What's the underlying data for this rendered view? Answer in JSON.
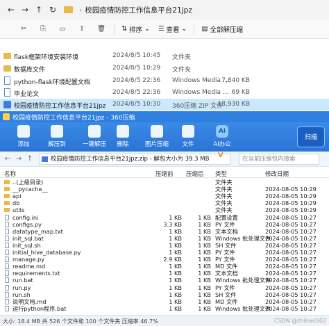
{
  "explorer": {
    "nav_back": "←",
    "nav_forward": "→",
    "nav_up": "↑",
    "nav_refresh": "↻",
    "breadcrumb_sep": "›",
    "path_title": "校园疫情防控工作信息平台21jpz",
    "ribbon": {
      "cut": "✂",
      "copy": "⎘",
      "rename": "▭",
      "share": "⇪",
      "delete": "🗑",
      "sort_label": "排序",
      "view_label": "查看",
      "extract_label": "全部解压缩"
    },
    "files": [
      {
        "name": "flask框架环境安装环境",
        "date": "2024/8/5 10:45",
        "type": "文件夹",
        "size": ""
      },
      {
        "name": "数据库文件",
        "date": "2024/8/5 10:29",
        "type": "文件夹",
        "size": ""
      },
      {
        "name": "python-flask环境配置文档",
        "date": "2024/8/5 22:36",
        "type": "Windows Media ...",
        "size": "7,840 KB"
      },
      {
        "name": "毕业论文",
        "date": "2024/8/5 22:36",
        "type": "Windows Media ...",
        "size": "69 KB"
      },
      {
        "name": "校园疫情防控工作信息平台21jpz",
        "date": "2024/8/5 10:30",
        "type": "360压缩 ZIP 文件",
        "size": "18,930 KB"
      }
    ]
  },
  "zip": {
    "title": "校园疫情防控工作信息平台21jpz - 360压缩",
    "toolbar": [
      {
        "label": "添加",
        "icon": "add-icon"
      },
      {
        "label": "解压到",
        "icon": "extract-icon"
      },
      {
        "label": "一键解压",
        "icon": "one-click-extract-icon"
      },
      {
        "label": "删除",
        "icon": "delete-icon"
      },
      {
        "label": "图片压缩",
        "icon": "image-compress-icon"
      },
      {
        "label": "文件",
        "icon": "file-icon"
      },
      {
        "label": "AI办公",
        "icon": "ai-office-icon"
      }
    ],
    "ai_badge": "AI",
    "scan_label": "扫描",
    "address": "校园疫情防控工作信息平台21jpz.zip - 解包大小为 39.3 MB",
    "address_mark": "V",
    "search_placeholder": "在当前压缩包内搜索",
    "columns": {
      "name": "名称",
      "compressed": "压缩前",
      "size": "压缩后",
      "type": "类型",
      "modified": "修改日期"
    },
    "rows": [
      {
        "name": "..(上级目录)",
        "c": "",
        "s": "",
        "t": "文件夹",
        "d": "",
        "folder": true
      },
      {
        "name": "__pycache__",
        "c": "",
        "s": "",
        "t": "文件夹",
        "d": "2024-08-05 10:29",
        "folder": true
      },
      {
        "name": "api",
        "c": "",
        "s": "",
        "t": "文件夹",
        "d": "2024-08-05 10:29",
        "folder": true
      },
      {
        "name": "db",
        "c": "",
        "s": "",
        "t": "文件夹",
        "d": "2024-08-05 10:29",
        "folder": true
      },
      {
        "name": "utils",
        "c": "",
        "s": "",
        "t": "文件夹",
        "d": "2024-08-05 10:29",
        "folder": true
      },
      {
        "name": "config.ini",
        "c": "1 KB",
        "s": "1 KB",
        "t": "配置设置",
        "d": "2024-08-05 10:27",
        "folder": false
      },
      {
        "name": "configs.py",
        "c": "3.3 KB",
        "s": "1 KB",
        "t": "PY 文件",
        "d": "2024-08-05 10:27",
        "folder": false
      },
      {
        "name": "datatype_map.txt",
        "c": "1 KB",
        "s": "1 KB",
        "t": "文本文档",
        "d": "2024-08-05 10:27",
        "folder": false
      },
      {
        "name": "init_sql.bat",
        "c": "1 KB",
        "s": "1 KB",
        "t": "Windows 批处理文件",
        "d": "2024-08-05 10:27",
        "folder": false
      },
      {
        "name": "init_sql.sh",
        "c": "1 KB",
        "s": "1 KB",
        "t": "SH 文件",
        "d": "2024-08-05 10:27",
        "folder": false
      },
      {
        "name": "initial_hive_database.py",
        "c": "1 KB",
        "s": "1 KB",
        "t": "PY 文件",
        "d": "2024-08-05 10:27",
        "folder": false
      },
      {
        "name": "manage.py",
        "c": "2.9 KB",
        "s": "1 KB",
        "t": "PY 文件",
        "d": "2024-08-05 10:27",
        "folder": false
      },
      {
        "name": "readme.md",
        "c": "1 KB",
        "s": "1 KB",
        "t": "MD 文件",
        "d": "2024-08-05 10:27",
        "folder": false
      },
      {
        "name": "requirements.txt",
        "c": "1 KB",
        "s": "1 KB",
        "t": "文本文档",
        "d": "2024-08-05 10:27",
        "folder": false
      },
      {
        "name": "run.bat",
        "c": "1 KB",
        "s": "1 KB",
        "t": "Windows 批处理文件",
        "d": "2024-08-05 10:27",
        "folder": false
      },
      {
        "name": "run.py",
        "c": "1 KB",
        "s": "1 KB",
        "t": "PY 文件",
        "d": "2024-08-05 10:27",
        "folder": false
      },
      {
        "name": "run.sh",
        "c": "1 KB",
        "s": "1 KB",
        "t": "SH 文件",
        "d": "2024-08-05 10:27",
        "folder": false
      },
      {
        "name": "说明文档.md",
        "c": "1 KB",
        "s": "1 KB",
        "t": "MD 文件",
        "d": "2024-08-05 10:27",
        "folder": false
      },
      {
        "name": "运行python程序.bat",
        "c": "1 KB",
        "s": "1 KB",
        "t": "Windows 批处理文件",
        "d": "2024-08-05 10:27",
        "folder": false
      }
    ],
    "status": "大小: 18.4 MB 共 526 个文件和 100 个文件夹 压缩率 46.7%",
    "watermark": "CSDN @zhihao502"
  }
}
